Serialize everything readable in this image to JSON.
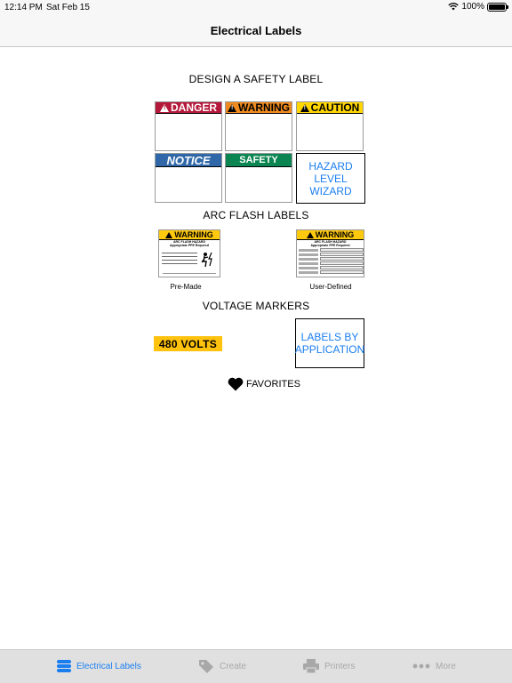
{
  "status_bar": {
    "time": "12:14 PM",
    "date": "Sat Feb 15",
    "battery": "100%",
    "battery_level": 1.0
  },
  "nav": {
    "title": "Electrical Labels"
  },
  "design_section": {
    "title": "DESIGN A SAFETY LABEL",
    "tiles": [
      {
        "label": "DANGER",
        "color": "#b5183a"
      },
      {
        "label": "WARNING",
        "color": "#ee8a1e"
      },
      {
        "label": "CAUTION",
        "color": "#ffd600"
      },
      {
        "label": "NOTICE",
        "color": "#2f67a8"
      },
      {
        "label": "SAFETY",
        "color": "#0b8551"
      }
    ],
    "hazard_wizard": "HAZARD LEVEL WIZARD"
  },
  "arc_section": {
    "title": "ARC FLASH LABELS",
    "premade": {
      "header": "WARNING",
      "sub1": "ARC FLASH HAZARD",
      "sub2": "Appropriate PPE Required",
      "caption": "Pre-Made"
    },
    "user_defined": {
      "header": "WARNING",
      "sub1": "ARC FLASH HAZARD",
      "sub2": "Appropriate PPE Required",
      "caption": "User-Defined"
    }
  },
  "voltage_section": {
    "title": "VOLTAGE MARKERS",
    "volts_label": "480 VOLTS",
    "volts_color": "#ffc20e",
    "labels_by_application": "LABELS BY APPLICATION"
  },
  "favorites": {
    "label": "FAVORITES",
    "icon": "heart-icon"
  },
  "tab_bar": {
    "accent": "#1a7ef0",
    "tabs": [
      {
        "label": "Electrical Labels",
        "icon": "stack-icon",
        "active": true
      },
      {
        "label": "Create",
        "icon": "tag-icon",
        "active": false
      },
      {
        "label": "Printers",
        "icon": "printer-icon",
        "active": false
      },
      {
        "label": "More",
        "icon": "more-dots-icon",
        "active": false
      }
    ]
  }
}
